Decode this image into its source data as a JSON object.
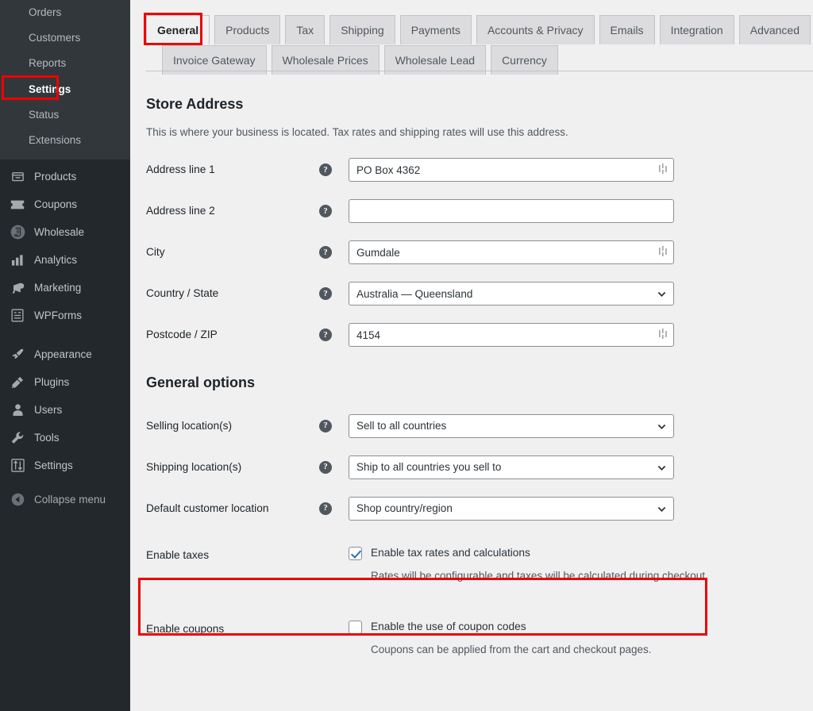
{
  "sidebar": {
    "submenu": [
      {
        "label": "Orders",
        "current": false
      },
      {
        "label": "Customers",
        "current": false
      },
      {
        "label": "Reports",
        "current": false
      },
      {
        "label": "Settings",
        "current": true
      },
      {
        "label": "Status",
        "current": false
      },
      {
        "label": "Extensions",
        "current": false
      }
    ],
    "menu": [
      {
        "label": "Products",
        "icon": "products-icon"
      },
      {
        "label": "Coupons",
        "icon": "coupons-icon"
      },
      {
        "label": "Wholesale",
        "icon": "wholesale-icon"
      },
      {
        "label": "Analytics",
        "icon": "analytics-icon"
      },
      {
        "label": "Marketing",
        "icon": "marketing-megaphone-icon"
      },
      {
        "label": "WPForms",
        "icon": "wpforms-icon"
      }
    ],
    "menu2": [
      {
        "label": "Appearance",
        "icon": "appearance-brush-icon"
      },
      {
        "label": "Plugins",
        "icon": "plugins-plug-icon"
      },
      {
        "label": "Users",
        "icon": "users-person-icon"
      },
      {
        "label": "Tools",
        "icon": "tools-wrench-icon"
      },
      {
        "label": "Settings",
        "icon": "settings-sliders-icon"
      }
    ],
    "collapse_label": "Collapse menu"
  },
  "tabs": {
    "row1": [
      {
        "label": "General",
        "active": true
      },
      {
        "label": "Products",
        "active": false
      },
      {
        "label": "Tax",
        "active": false
      },
      {
        "label": "Shipping",
        "active": false
      },
      {
        "label": "Payments",
        "active": false
      },
      {
        "label": "Accounts & Privacy",
        "active": false
      },
      {
        "label": "Emails",
        "active": false
      },
      {
        "label": "Integration",
        "active": false
      },
      {
        "label": "Advanced",
        "active": false
      }
    ],
    "row2": [
      {
        "label": "Invoice Gateway",
        "active": false
      },
      {
        "label": "Wholesale Prices",
        "active": false
      },
      {
        "label": "Wholesale Lead",
        "active": false
      },
      {
        "label": "Currency",
        "active": false
      }
    ]
  },
  "store_address": {
    "title": "Store Address",
    "description": "This is where your business is located. Tax rates and shipping rates will use this address.",
    "fields": [
      {
        "label": "Address line 1",
        "value": "PO Box 4362",
        "type": "text",
        "placeholder": ""
      },
      {
        "label": "Address line 2",
        "value": "",
        "type": "text",
        "placeholder": ""
      },
      {
        "label": "City",
        "value": "Gumdale",
        "type": "text",
        "placeholder": ""
      },
      {
        "label": "Country / State",
        "value": "Australia — Queensland",
        "type": "select",
        "placeholder": ""
      },
      {
        "label": "Postcode / ZIP",
        "value": "4154",
        "type": "text",
        "placeholder": ""
      }
    ]
  },
  "general_options": {
    "title": "General options",
    "selects": [
      {
        "label": "Selling location(s)",
        "value": "Sell to all countries"
      },
      {
        "label": "Shipping location(s)",
        "value": "Ship to all countries you sell to"
      },
      {
        "label": "Default customer location",
        "value": "Shop country/region"
      }
    ],
    "enable_taxes": {
      "label": "Enable taxes",
      "checkbox_label": "Enable tax rates and calculations",
      "description": "Rates will be configurable and taxes will be calculated during checkout.",
      "checked": true
    },
    "enable_coupons": {
      "label": "Enable coupons",
      "checkbox_label": "Enable the use of coupon codes",
      "description": "Coupons can be applied from the cart and checkout pages.",
      "checked": false
    }
  },
  "icons": {
    "help": "?",
    "chevron_down": "chevron-down-icon",
    "resize_handle": "resize-handle-icon"
  },
  "colors": {
    "highlight_red": "#ee0000",
    "sidebar_bg": "#23282d",
    "submenu_bg": "#32373c",
    "content_bg": "#f0f0f1",
    "checkbox_blue": "#2271b1"
  }
}
